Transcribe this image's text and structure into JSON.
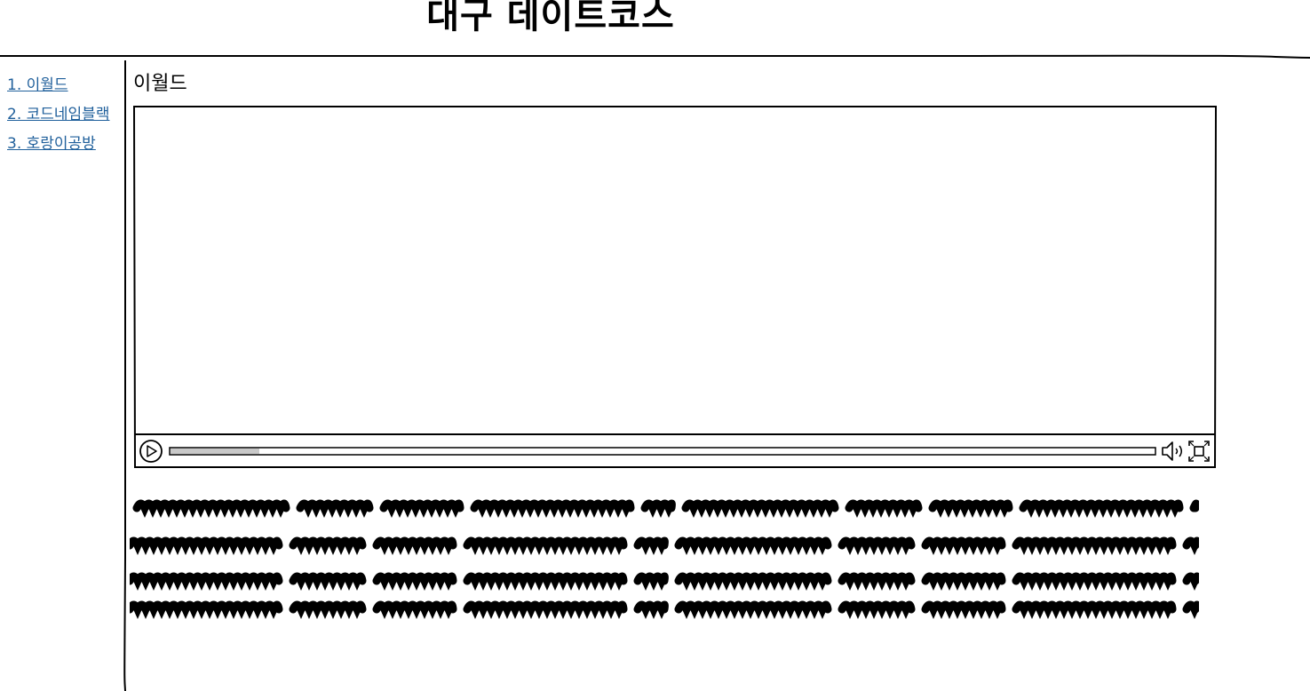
{
  "header": {
    "title": "대구 데이트코스"
  },
  "sidebar": {
    "items": [
      {
        "label": "1. 이월드"
      },
      {
        "label": "2. 코드네임블랙"
      },
      {
        "label": "3. 호랑이공방"
      }
    ]
  },
  "main": {
    "title": "이월드",
    "video": {
      "progress": 0.09,
      "controls": {
        "play_icon": "play-icon",
        "volume_icon": "volume-icon",
        "fullscreen_icon": "fullscreen-icon"
      }
    }
  },
  "colors": {
    "link": "#1f5f9b",
    "ink": "#000000",
    "progress_fill": "#c8c8c8"
  }
}
